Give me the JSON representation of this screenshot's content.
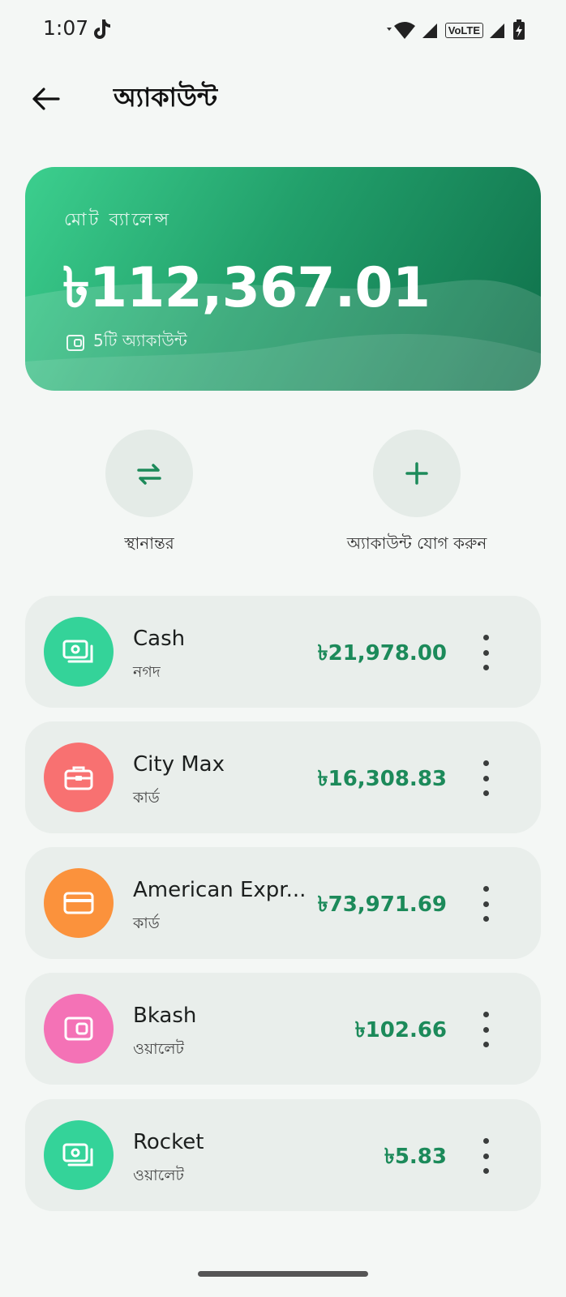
{
  "status_bar": {
    "time": "1:07",
    "volte": "VoLTE"
  },
  "header": {
    "title": "অ্যাকাউন্ট"
  },
  "balance_card": {
    "label": "মোট ব্যালেন্স",
    "amount": "৳112,367.01",
    "account_count": "5টি অ্যাকাউন্ট"
  },
  "actions": {
    "transfer_label": "স্থানান্তর",
    "add_label": "অ্যাকাউন্ট যোগ করুন"
  },
  "accounts": [
    {
      "name": "Cash",
      "type": "নগদ",
      "balance": "৳21,978.00",
      "icon": "cash-icon",
      "color": "#34d399"
    },
    {
      "name": "City Max",
      "type": "কার্ড",
      "balance": "৳16,308.83",
      "icon": "briefcase-icon",
      "color": "#f87171"
    },
    {
      "name": "American Expr...",
      "type": "কার্ড",
      "balance": "৳73,971.69",
      "icon": "credit-card-icon",
      "color": "#fb923c"
    },
    {
      "name": "Bkash",
      "type": "ওয়ালেট",
      "balance": "৳102.66",
      "icon": "wallet-icon",
      "color": "#f472b6"
    },
    {
      "name": "Rocket",
      "type": "ওয়ালেট",
      "balance": "৳5.83",
      "icon": "cash-icon",
      "color": "#34d399"
    }
  ],
  "colors": {
    "accent": "#1c8a5a",
    "background": "#f4f7f5",
    "card": "#e9eeeb"
  }
}
